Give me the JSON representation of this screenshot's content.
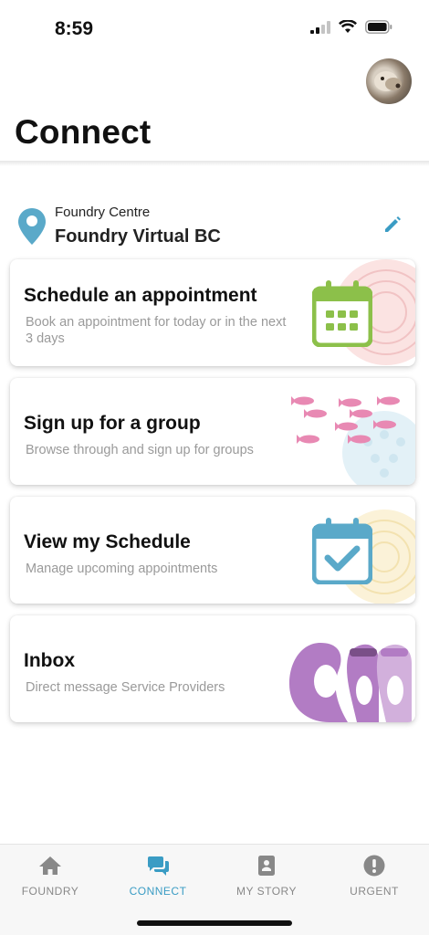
{
  "status": {
    "time": "8:59"
  },
  "header": {
    "title": "Connect"
  },
  "location": {
    "label": "Foundry Centre",
    "name": "Foundry Virtual BC"
  },
  "cards": [
    {
      "title": "Schedule an appointment",
      "desc_line1": "Book an appointment for today or in the next",
      "desc_line2": "3 days",
      "icon": "calendar-grid-icon"
    },
    {
      "title": "Sign up for a group",
      "desc": "Browse through and sign up for groups",
      "icon": "fish-school-icon"
    },
    {
      "title": "View my Schedule",
      "desc": "Manage upcoming appointments",
      "icon": "calendar-check-icon"
    },
    {
      "title": "Inbox",
      "desc": "Direct message Service Providers",
      "icon": "otters-icon"
    }
  ],
  "nav": [
    {
      "label": "FOUNDRY",
      "icon": "home-icon"
    },
    {
      "label": "CONNECT",
      "icon": "chat-icon",
      "active": true
    },
    {
      "label": "MY STORY",
      "icon": "book-icon"
    },
    {
      "label": "URGENT",
      "icon": "alert-icon"
    }
  ],
  "colors": {
    "accent": "#3a9cc4",
    "calendar_green": "#8cc04a",
    "calendar_blue": "#5aa9c9",
    "fish_pink": "#e889b3",
    "otter_purple": "#b27cc4"
  }
}
